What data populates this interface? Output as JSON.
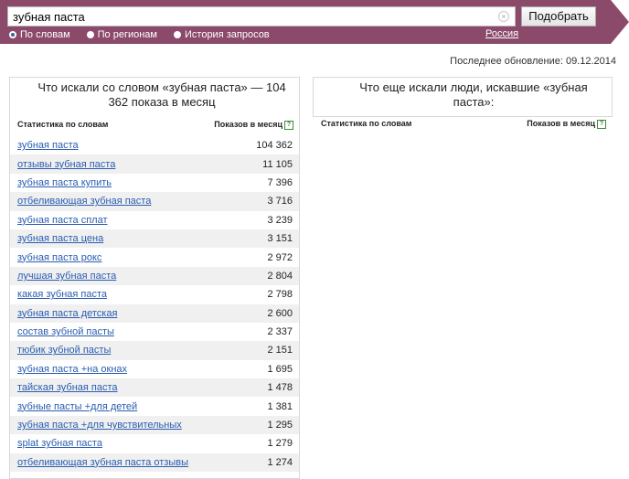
{
  "search": {
    "value": "зубная паста",
    "clear_icon": "×",
    "submit_label": "Подобрать",
    "colors": {
      "header_bg": "#8b4a6a",
      "selected_radio": "#2f63ad"
    }
  },
  "modes": [
    {
      "label": "По словам",
      "checked": true
    },
    {
      "label": "По регионам",
      "checked": false
    },
    {
      "label": "История запросов",
      "checked": false
    }
  ],
  "region": "Россия",
  "updated": "Последнее обновление: 09.12.2014",
  "left_panel": {
    "title": "Что искали со словом «зубная паста» — 104 362 показа в месяц",
    "col_phrase": "Статистика по словам",
    "col_count": "Показов в месяц",
    "help_icon": "?",
    "rows": [
      {
        "phrase": "зубная паста",
        "count": "104 362"
      },
      {
        "phrase": "отзывы зубная паста",
        "count": "11 105"
      },
      {
        "phrase": "зубная паста купить",
        "count": "7 396"
      },
      {
        "phrase": "отбеливающая зубная паста",
        "count": "3 716"
      },
      {
        "phrase": "зубная паста сплат",
        "count": "3 239"
      },
      {
        "phrase": "зубная паста цена",
        "count": "3 151"
      },
      {
        "phrase": "зубная паста рокс",
        "count": "2 972"
      },
      {
        "phrase": "лучшая зубная паста",
        "count": "2 804"
      },
      {
        "phrase": "какая зубная паста",
        "count": "2 798"
      },
      {
        "phrase": "зубная паста детская",
        "count": "2 600"
      },
      {
        "phrase": "состав зубной пасты",
        "count": "2 337"
      },
      {
        "phrase": "тюбик зубной пасты",
        "count": "2 151"
      },
      {
        "phrase": "зубная паста +на окнах",
        "count": "1 695"
      },
      {
        "phrase": "тайская зубная паста",
        "count": "1 478"
      },
      {
        "phrase": "зубные пасты +для детей",
        "count": "1 381"
      },
      {
        "phrase": "зубная паста +для чувствительных",
        "count": "1 295"
      },
      {
        "phrase": "splat зубная паста",
        "count": "1 279"
      },
      {
        "phrase": "отбеливающая зубная паста отзывы",
        "count": "1 274"
      }
    ]
  },
  "right_panel": {
    "title": "Что еще искали люди, искавшие «зубная паста»:",
    "col_phrase": "Статистика по словам",
    "col_count": "Показов в месяц",
    "help_icon": "?"
  }
}
